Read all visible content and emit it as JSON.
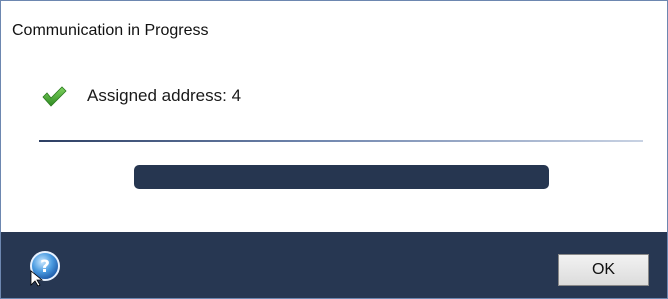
{
  "window": {
    "title": "Communication in Progress"
  },
  "status": {
    "icon": "check-icon",
    "text": "Assigned address: 4"
  },
  "progress": {
    "fraction": 1.0
  },
  "footer": {
    "help_icon": "help-icon",
    "ok_label": "OK"
  },
  "colors": {
    "footer_background": "#273752",
    "progress_fill": "#263650",
    "check": "#3f9f2a"
  }
}
